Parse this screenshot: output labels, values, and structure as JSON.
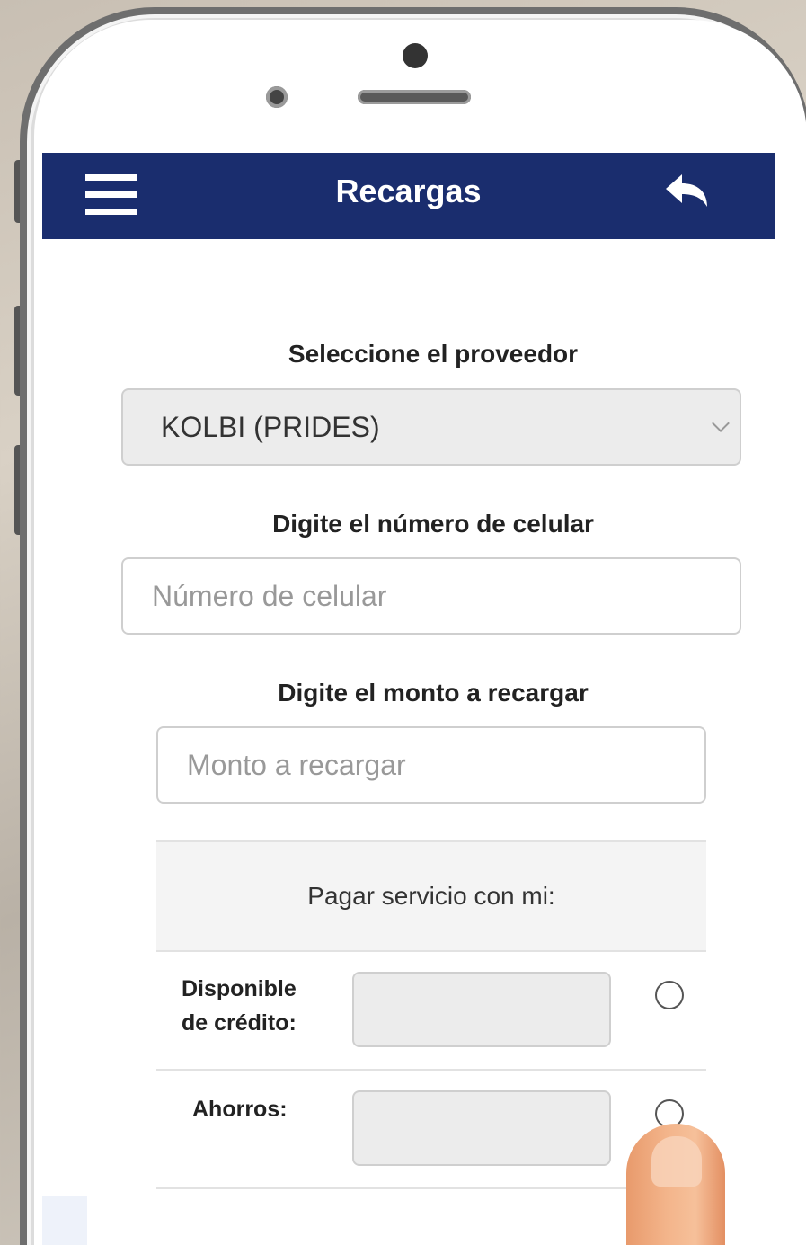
{
  "header": {
    "title": "Recargas",
    "menu_icon": "hamburger-menu-icon",
    "back_icon": "reply-arrow-icon",
    "bar_color": "#1a2d6e"
  },
  "form": {
    "provider_label": "Seleccione el proveedor",
    "provider_selected": "KOLBI (PRIDES)",
    "phone_label": "Digite el número de celular",
    "phone_placeholder": "Número de celular",
    "phone_value": "",
    "amount_label": "Digite el monto a recargar",
    "amount_placeholder": "Monto a recargar",
    "amount_value": ""
  },
  "payment": {
    "header": "Pagar servicio con mi:",
    "options": [
      {
        "label_line1": "Disponible",
        "label_line2": "de crédito:",
        "value": "",
        "selected": false
      },
      {
        "label_line1": "Ahorros:",
        "label_line2": "",
        "value": "",
        "selected": false
      }
    ]
  }
}
